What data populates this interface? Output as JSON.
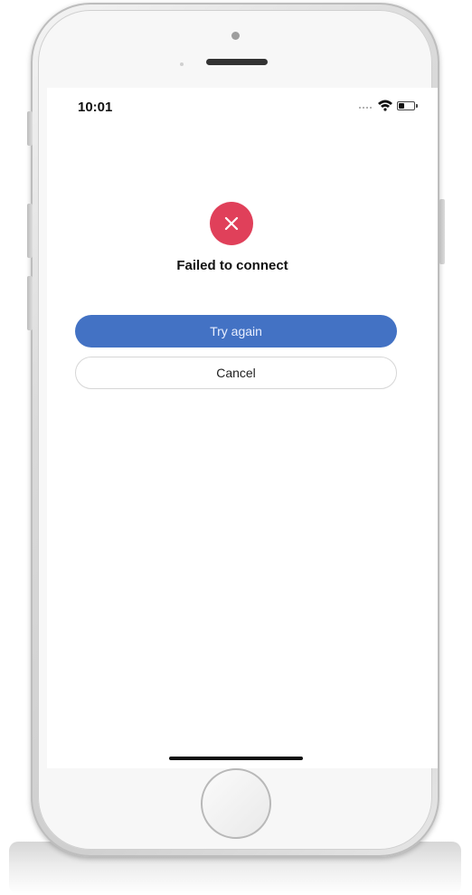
{
  "status_bar": {
    "time": "10:01",
    "battery_level": 0.4,
    "icons": [
      "signal-dots-icon",
      "wifi-icon",
      "battery-icon"
    ]
  },
  "dialog": {
    "icon": "error-x-icon",
    "title": "Failed to connect",
    "primary_button": "Try again",
    "secondary_button": "Cancel"
  },
  "colors": {
    "error_red": "#e0405a",
    "primary_blue": "#4372c4",
    "text_dark": "#111111",
    "border_gray": "#d6d6d6"
  },
  "device": {
    "type": "iPhone mockup",
    "home_button_icon": "home-button",
    "home_indicator": "home-indicator-bar"
  }
}
